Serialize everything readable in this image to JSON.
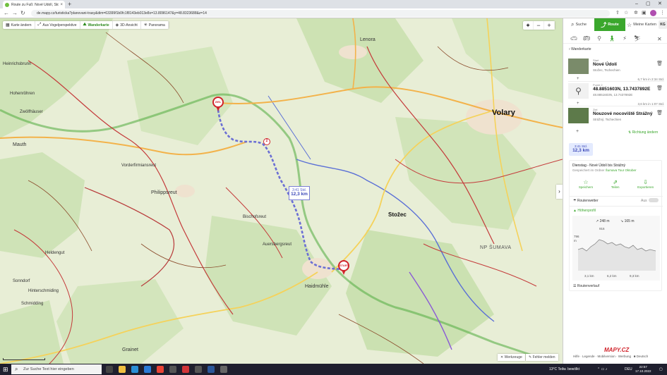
{
  "browser": {
    "tab_title": "Route zu Fuß: Nové Údolí, Stožec",
    "url": "de.mapy.cz/turisticka?planovani-trasy&dim=63399f1b0fc1f8143eb013e8x=13.8096147&y=48.8323688&z=14"
  },
  "map_toolbar": {
    "items": [
      "Karte ändern",
      "Aus Vogelperspektive",
      "Wanderkarte",
      "3D-Ansicht",
      "Panorama"
    ]
  },
  "zoom": {
    "minus": "−",
    "plus": "+"
  },
  "map": {
    "places": [
      "Heinrichsbrunn",
      "Hohenröhren",
      "Zwölfhäuser",
      "Mauth",
      "Vorderfirmiansreut",
      "Philippsreut",
      "Bischofsreut",
      "Auersbergsreut",
      "Heldengut",
      "Sonndorf",
      "Hinterschmiding",
      "Schmidding",
      "Haidmühle",
      "Grainet",
      "Lenora",
      "Volary",
      "Stožec",
      "NP ŠUMAVA"
    ],
    "start_pin": "START",
    "end_pin": "ZIEL",
    "waypoint_number": "2",
    "route_time": "3:41 Std.",
    "route_distance": "12,3 km",
    "tools_label": "Werkzeuge",
    "report_label": "Fehler melden"
  },
  "panel": {
    "tabs": {
      "search": "Suche",
      "route": "Route",
      "my_maps": "Meine Karten",
      "user_initials": "KG"
    },
    "route_type": "Wanderkarte",
    "waypoints": [
      {
        "label": "Start",
        "name": "Nové Údolí",
        "sub": "Stožec, Tschechien"
      },
      {
        "label": "Punkt 2",
        "name": "48.8851603N, 13.7437892E",
        "sub": "48.8851603N, 13.7437892E"
      },
      {
        "label": "Ziel",
        "name": "Nouzové nocoviště Strážný",
        "sub": "Strážný, Tschechien"
      }
    ],
    "segments": [
      "6,7 km in 2:34 Std.",
      "3,6 km in 1:07 Std."
    ],
    "reverse": "Richtung ändern",
    "summary": {
      "time": "3:41 Std.",
      "distance": "12,3 km"
    },
    "route_card": {
      "title": "Dienstag - Nové Údolí bis Strážný",
      "saved_prefix": "Gespeichert im Ordner",
      "saved_folder": "Šumava Tour Oktober",
      "actions": [
        "Speichern",
        "Teilen",
        "Exportieren"
      ],
      "weather": "Routenwetter",
      "weather_state": "Aus",
      "elevation_title": "Höhenprofil",
      "ascent": "248 m",
      "descent": "165 m",
      "peak": "916",
      "y_labels": [
        "796",
        "m"
      ],
      "x_labels": [
        "3,1 km",
        "6,2 km",
        "9,3 km"
      ],
      "course": "Routenverlauf"
    },
    "logo": "MAPY.CZ",
    "footer": "Hilfe · Legende · Mobilversion · Werbung",
    "language": "Deutsch"
  },
  "taskbar": {
    "search_placeholder": "Zur Suche Text hier eingeben",
    "weather": "13°C  Teilw. bewölkt",
    "lang": "DEU",
    "time": "22:57",
    "date": "17.10.2022"
  },
  "colors": {
    "accent": "#3aa72c",
    "route": "#6b6fd4",
    "pin": "#d0232b"
  }
}
